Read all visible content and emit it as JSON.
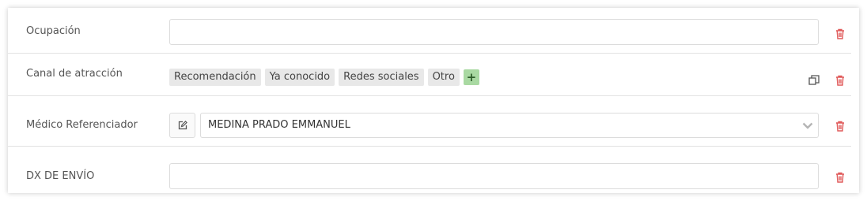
{
  "form": {
    "rows": [
      {
        "label": "Ocupación",
        "value": ""
      },
      {
        "label": "Canal de atracción",
        "tags": [
          "Recomendación",
          "Ya conocido",
          "Redes sociales",
          "Otro"
        ],
        "add_label": "+"
      },
      {
        "label": "Médico Referenciador",
        "selected": "MEDINA PRADO EMMANUEL"
      },
      {
        "label": "DX DE ENVÍO",
        "value": ""
      }
    ]
  },
  "colors": {
    "delete_icon": "#e05a5a",
    "tag_bg": "#e8e8e8",
    "add_tag_bg": "#a9d9a2"
  }
}
